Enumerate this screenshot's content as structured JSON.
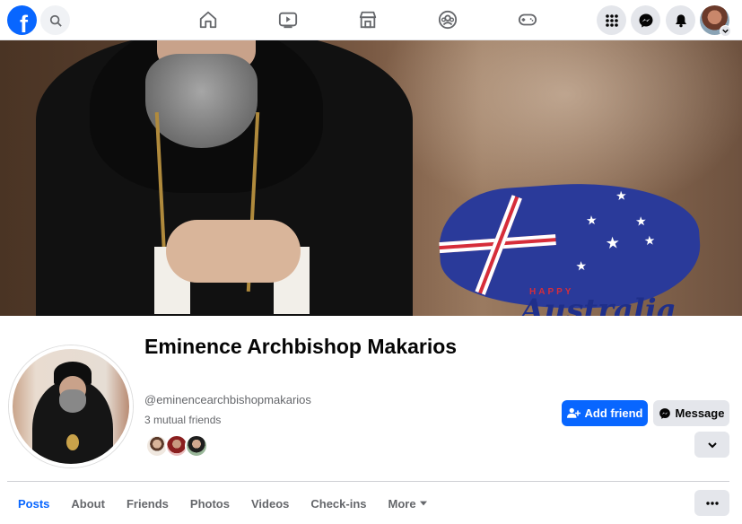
{
  "topbar": {
    "logo_letter": "f",
    "nav_icons": [
      "home-icon",
      "video-icon",
      "marketplace-icon",
      "groups-icon",
      "gaming-icon"
    ],
    "right_icons": [
      "menu-grid-icon",
      "messenger-icon",
      "bell-icon"
    ]
  },
  "cover": {
    "small_text": "HAPPY",
    "big_text": "Australia"
  },
  "profile": {
    "name": "Eminence Archbishop Makarios",
    "handle": "@eminencearchbishopmakarios",
    "mutual_friends": "3 mutual friends"
  },
  "actions": {
    "add_friend": "Add friend",
    "message": "Message"
  },
  "tabs": [
    {
      "label": "Posts",
      "active": true
    },
    {
      "label": "About"
    },
    {
      "label": "Friends"
    },
    {
      "label": "Photos"
    },
    {
      "label": "Videos"
    },
    {
      "label": "Check-ins"
    },
    {
      "label": "More"
    }
  ],
  "colors": {
    "brand": "#0866ff",
    "button_grey": "#e4e6eb",
    "secondary_text": "#65676b"
  }
}
